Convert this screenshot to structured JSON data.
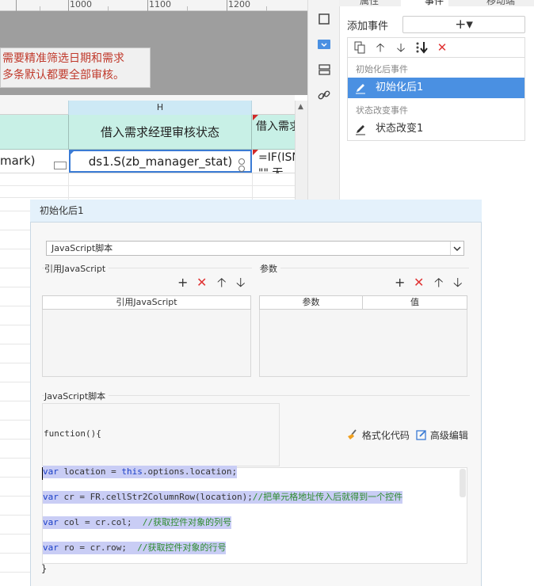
{
  "ruler": {
    "labels": [
      "1000",
      "1100",
      "1200"
    ]
  },
  "note": {
    "line1": "需要精准筛选日期和需求",
    "line2": "多条默认都要全部审核。"
  },
  "sheet": {
    "column_h_label": "H",
    "header_h": "借入需求经理审核状态",
    "header_i": "借入需求",
    "cell_g": "mark)",
    "cell_h": "ds1.S(zb_manager_stat)",
    "cell_i_line1": "=IF(ISN",
    "cell_i_line2": "\"\" 无"
  },
  "right_panel": {
    "tabs": [
      "属性",
      "事件",
      "移动端"
    ],
    "add_event_label": "添加事件",
    "add_event_button": "+▾",
    "groups": [
      {
        "title": "初始化后事件",
        "items": [
          {
            "label": "初始化后1",
            "selected": true
          }
        ]
      },
      {
        "title": "状态改变事件",
        "items": [
          {
            "label": "状态改变1",
            "selected": false
          }
        ]
      }
    ]
  },
  "dialog": {
    "title": "初始化后1",
    "script_type": "JavaScript脚本",
    "ref_js_section": "引用JavaScript",
    "params_section": "参数",
    "ref_js_column": "引用JavaScript",
    "params_columns": [
      "参数",
      "值"
    ],
    "js_section": "JavaScript脚本",
    "function_header": "function(){",
    "format_button": "格式化代码",
    "advanced_button": "高级编辑",
    "closing_brace": "}",
    "code": {
      "l1_kw": "var",
      "l1_rest_a": " location = ",
      "l1_kw2": "this",
      "l1_rest_b": ".options.location;",
      "l2_kw": "var",
      "l2_rest": " cr = FR.cellStr2ColumnRow(location);",
      "l2_comment": "//把单元格地址传入后就得到一个控件",
      "l3_kw": "var",
      "l3_rest": " col = cr.col;  ",
      "l3_comment": "//获取控件对象的列号",
      "l4_kw": "var",
      "l4_rest": " ro = cr.row;  ",
      "l4_comment": "//获取控件对象的行号"
    }
  },
  "colors": {
    "accent": "#4a90e2",
    "danger": "#e03434",
    "header_bg": "#c8f0e6",
    "dialog_title_bg": "#e4f1fb",
    "code_selection": "#c9cdf5"
  }
}
